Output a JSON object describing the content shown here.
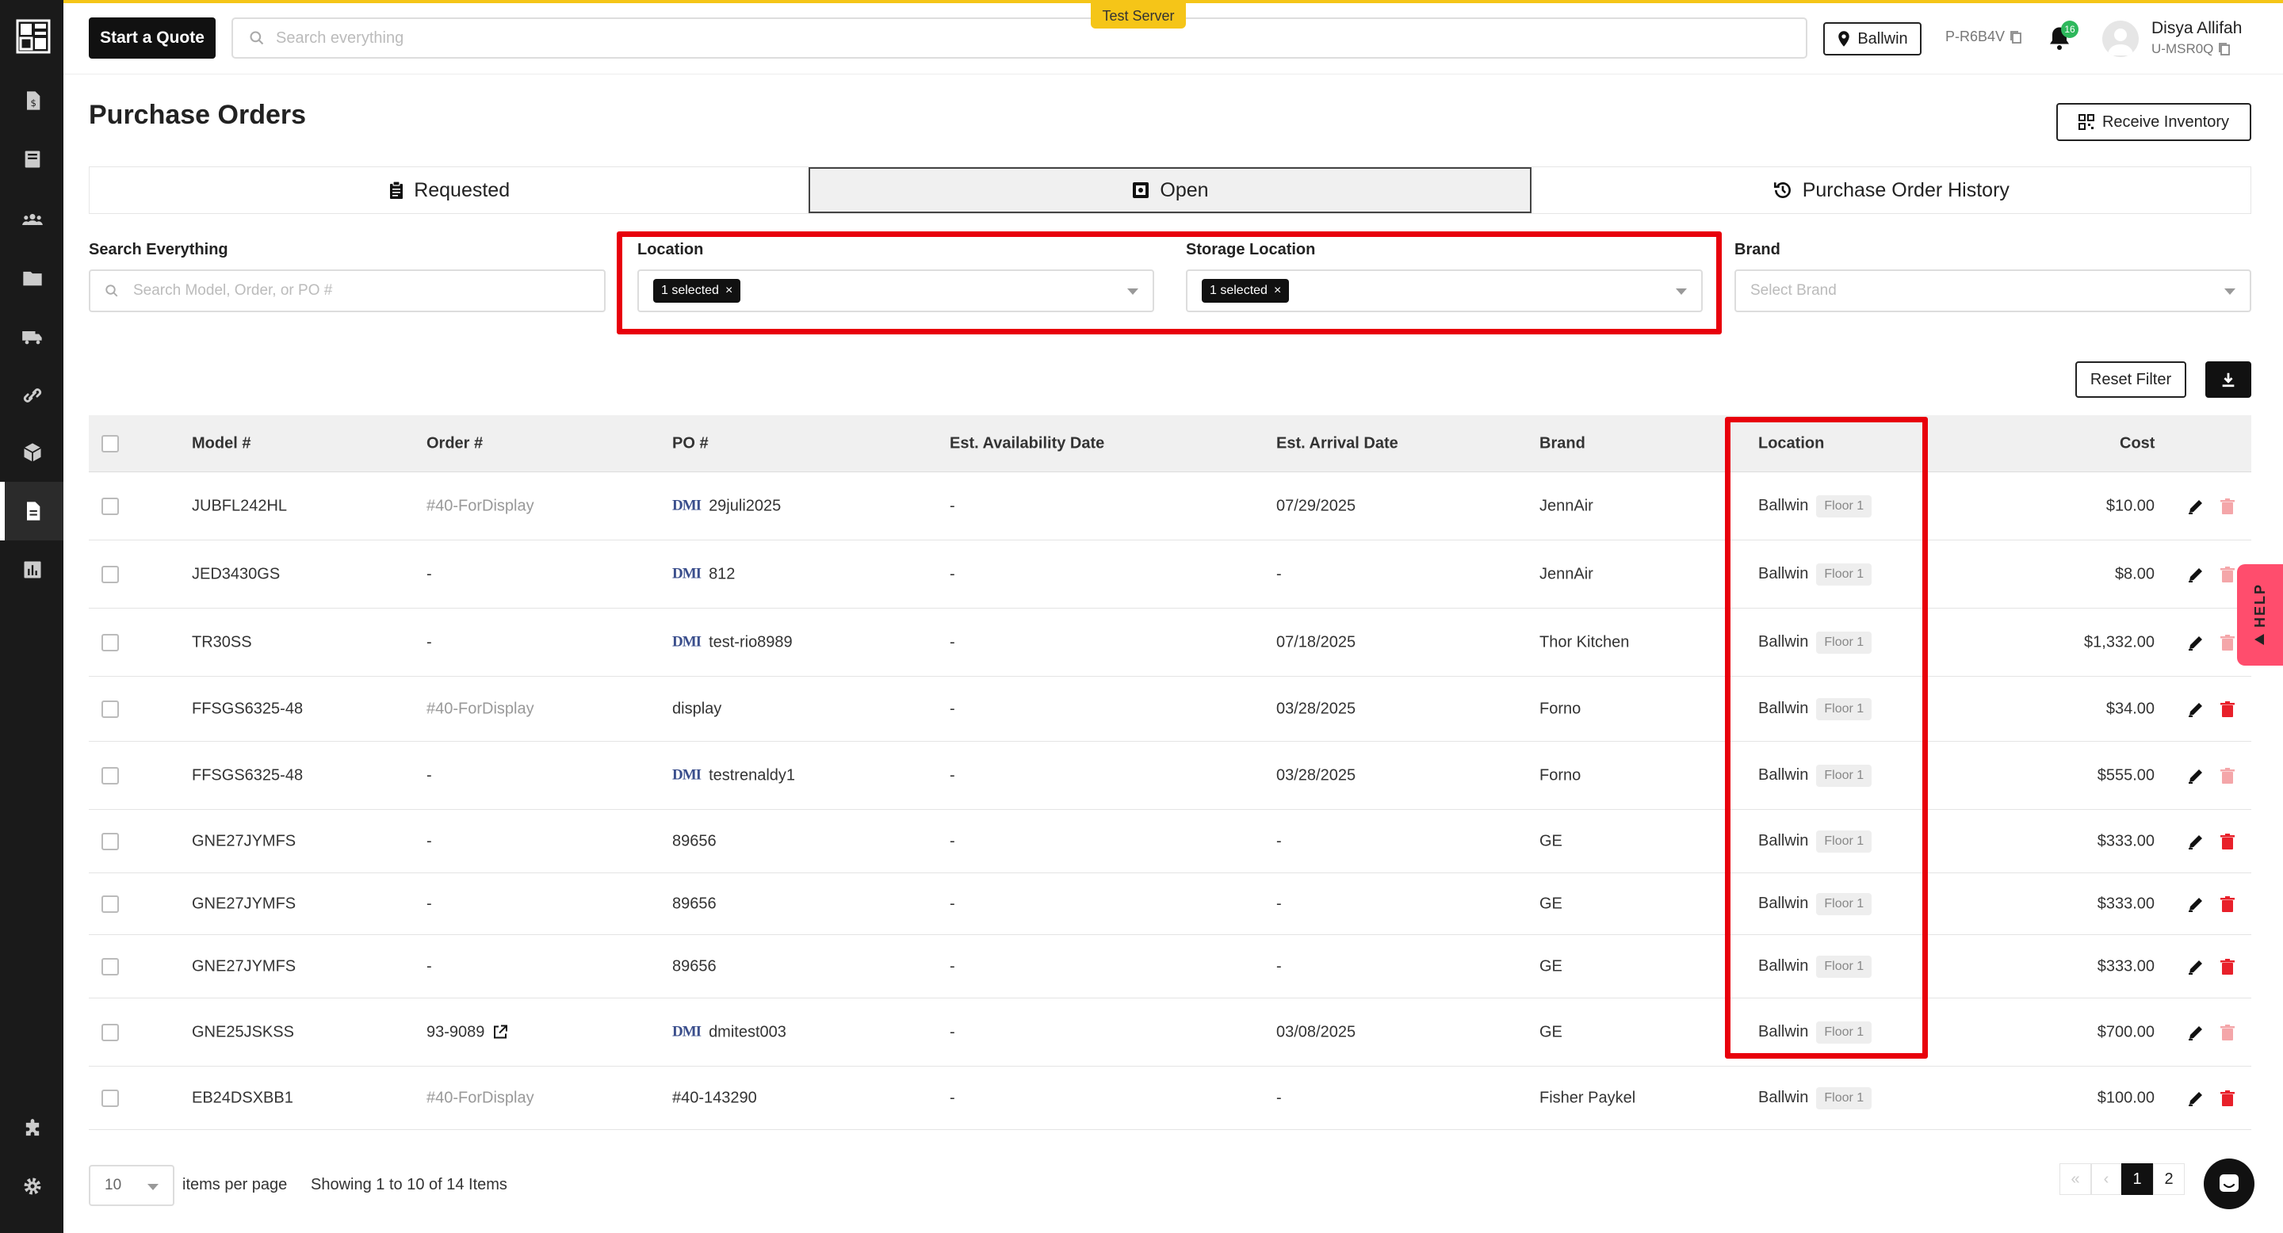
{
  "header": {
    "quote_label": "Start a Quote",
    "search_placeholder": "Search everything",
    "server_badge": "Test Server",
    "location": "Ballwin",
    "p_code": "P-R6B4V",
    "notif_count": "16",
    "user_name": "Disya Allifah",
    "user_code": "U-MSR0Q"
  },
  "page": {
    "title": "Purchase Orders",
    "receive_label": "Receive Inventory"
  },
  "tabs": [
    {
      "label": "Requested"
    },
    {
      "label": "Open"
    },
    {
      "label": "Purchase Order History"
    }
  ],
  "filters": {
    "search_label": "Search Everything",
    "search_placeholder": "Search Model, Order, or PO #",
    "location_label": "Location",
    "location_chip": "1 selected",
    "storage_label": "Storage Location",
    "storage_chip": "1 selected",
    "brand_label": "Brand",
    "brand_placeholder": "Select Brand",
    "reset_label": "Reset Filter"
  },
  "table": {
    "columns": [
      "Model #",
      "Order #",
      "PO #",
      "Est. Availability Date",
      "Est. Arrival Date",
      "Brand",
      "Location",
      "Cost"
    ],
    "rows": [
      {
        "model": "JUBFL242HL",
        "order": "#40-ForDisplay",
        "order_muted": true,
        "dmi": true,
        "po": "29juli2025",
        "avail": "-",
        "arrival": "07/29/2025",
        "brand": "JennAir",
        "location": "Ballwin",
        "floor": "Floor 1",
        "cost": "$10.00",
        "del_active": false
      },
      {
        "model": "JED3430GS",
        "order": "-",
        "order_muted": false,
        "dmi": true,
        "po": "812",
        "avail": "-",
        "arrival": "-",
        "brand": "JennAir",
        "location": "Ballwin",
        "floor": "Floor 1",
        "cost": "$8.00",
        "del_active": false
      },
      {
        "model": "TR30SS",
        "order": "-",
        "order_muted": false,
        "dmi": true,
        "po": "test-rio8989",
        "avail": "-",
        "arrival": "07/18/2025",
        "brand": "Thor Kitchen",
        "location": "Ballwin",
        "floor": "Floor 1",
        "cost": "$1,332.00",
        "del_active": false
      },
      {
        "model": "FFSGS6325-48",
        "order": "#40-ForDisplay",
        "order_muted": true,
        "dmi": false,
        "po": "display",
        "avail": "-",
        "arrival": "03/28/2025",
        "brand": "Forno",
        "location": "Ballwin",
        "floor": "Floor 1",
        "cost": "$34.00",
        "del_active": true
      },
      {
        "model": "FFSGS6325-48",
        "order": "-",
        "order_muted": false,
        "dmi": true,
        "po": "testrenaldy1",
        "avail": "-",
        "arrival": "03/28/2025",
        "brand": "Forno",
        "location": "Ballwin",
        "floor": "Floor 1",
        "cost": "$555.00",
        "del_active": false
      },
      {
        "model": "GNE27JYMFS",
        "order": "-",
        "order_muted": false,
        "dmi": false,
        "po": "89656",
        "avail": "-",
        "arrival": "-",
        "brand": "GE",
        "location": "Ballwin",
        "floor": "Floor 1",
        "cost": "$333.00",
        "del_active": true
      },
      {
        "model": "GNE27JYMFS",
        "order": "-",
        "order_muted": false,
        "dmi": false,
        "po": "89656",
        "avail": "-",
        "arrival": "-",
        "brand": "GE",
        "location": "Ballwin",
        "floor": "Floor 1",
        "cost": "$333.00",
        "del_active": true
      },
      {
        "model": "GNE27JYMFS",
        "order": "-",
        "order_muted": false,
        "dmi": false,
        "po": "89656",
        "avail": "-",
        "arrival": "-",
        "brand": "GE",
        "location": "Ballwin",
        "floor": "Floor 1",
        "cost": "$333.00",
        "del_active": true
      },
      {
        "model": "GNE25JSKSS",
        "order": "93-9089",
        "order_muted": false,
        "order_link": true,
        "dmi": true,
        "po": "dmitest003",
        "avail": "-",
        "arrival": "03/08/2025",
        "brand": "GE",
        "location": "Ballwin",
        "floor": "Floor 1",
        "cost": "$700.00",
        "del_active": false
      },
      {
        "model": "EB24DSXBB1",
        "order": "#40-ForDisplay",
        "order_muted": true,
        "dmi": false,
        "po": "#40-143290",
        "avail": "-",
        "arrival": "-",
        "brand": "Fisher Paykel",
        "location": "Ballwin",
        "floor": "Floor 1",
        "cost": "$100.00",
        "del_active": true
      }
    ]
  },
  "dmi_label": "DMI",
  "pagination": {
    "per_page": "10",
    "per_page_label": "items per page",
    "showing": "Showing 1 to 10 of 14 Items",
    "pages": [
      "1",
      "2"
    ],
    "first": "«",
    "prev": "‹"
  },
  "help_label": "HELP",
  "colors": {
    "accent": "#f5c518",
    "highlight": "#e8000b",
    "delete": "#e8202a",
    "delete_disabled": "#f4a6a9"
  }
}
